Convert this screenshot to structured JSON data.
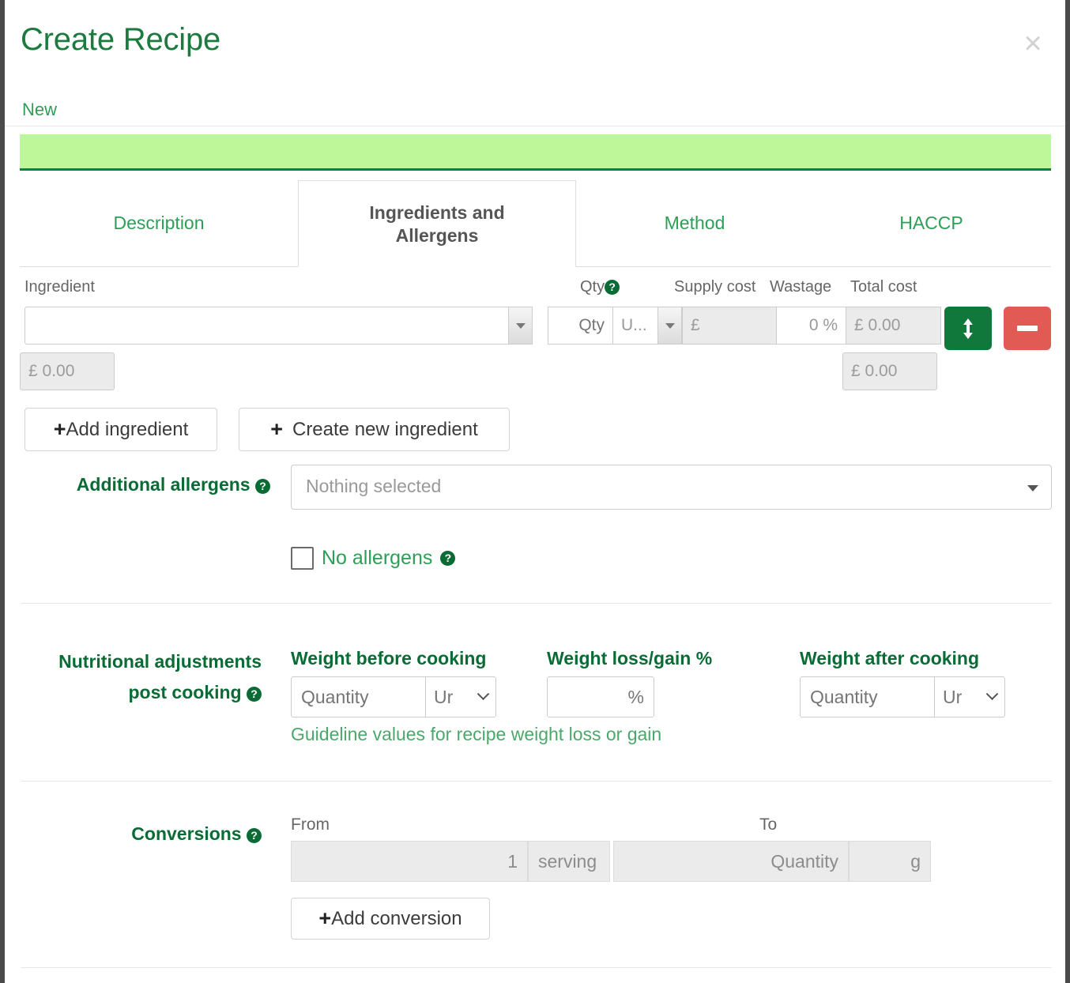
{
  "modal": {
    "title": "Create Recipe",
    "subtitle": "New",
    "close_label": "×"
  },
  "tabs": [
    {
      "label": "Description",
      "active": false
    },
    {
      "label": "Ingredients and Allergens",
      "label_line1": "Ingredients and",
      "label_line2": "Allergens",
      "active": true
    },
    {
      "label": "Method",
      "active": false
    },
    {
      "label": "HACCP",
      "active": false
    }
  ],
  "ingredients": {
    "headers": {
      "ingredient": "Ingredient",
      "qty": "Qty",
      "supply_cost": "Supply cost",
      "wastage": "Wastage",
      "total_cost": "Total cost"
    },
    "row": {
      "name_value": "",
      "qty_placeholder": "Qty",
      "unit_value": "U...",
      "supply_value": "£",
      "wastage_value": "0 %",
      "total_value": "£ 0.00"
    },
    "subtotals": {
      "supply": "£ 0.00",
      "total": "£ 0.00"
    },
    "add_ingredient_label": "Add ingredient",
    "create_new_ingredient_label": "Create new ingredient",
    "plus_icon": "+"
  },
  "allergens": {
    "label": "Additional allergens",
    "select_placeholder": "Nothing selected",
    "no_allergens_label": "No allergens",
    "no_allergens_checked": false
  },
  "nutrition": {
    "label_line1": "Nutritional adjustments",
    "label_line2": "post cooking",
    "weight_before_label": "Weight before cooking",
    "weight_loss_label": "Weight loss/gain %",
    "weight_after_label": "Weight after cooking",
    "quantity_placeholder": "Quantity",
    "unit_value": "Ur",
    "percent_value": "%",
    "guideline_text": "Guideline values for recipe weight loss or gain"
  },
  "conversions": {
    "label": "Conversions",
    "from_header": "From",
    "to_header": "To",
    "from_qty": "1",
    "from_unit": "serving",
    "to_qty_placeholder": "Quantity",
    "to_unit": "g",
    "add_conversion_label": "Add conversion"
  },
  "colors": {
    "brand_green": "#0b6b35",
    "link_green": "#2e9e57",
    "banner_green": "#bdf79a",
    "banner_border": "#10803f",
    "move_button": "#11783c",
    "remove_button": "#e15a53"
  },
  "icons": {
    "help": "?",
    "move": "↕",
    "remove": "−"
  }
}
